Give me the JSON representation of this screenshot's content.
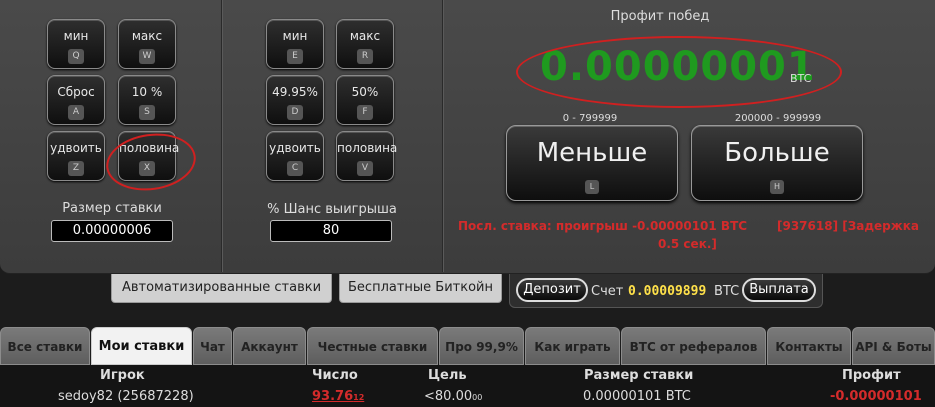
{
  "controls_left": {
    "buttons": [
      {
        "label": "мин",
        "key": "Q"
      },
      {
        "label": "макс",
        "key": "W"
      },
      {
        "label": "Сброс",
        "key": "A"
      },
      {
        "label": "10 %",
        "key": "S"
      },
      {
        "label": "удвоить",
        "key": "Z"
      },
      {
        "label": "половина",
        "key": "X"
      }
    ],
    "field_label": "Размер ставки",
    "field_value": "0.00000006"
  },
  "controls_mid": {
    "buttons": [
      {
        "label": "мин",
        "key": "E"
      },
      {
        "label": "макс",
        "key": "R"
      },
      {
        "label": "49.95%",
        "key": "D"
      },
      {
        "label": "50%",
        "key": "F"
      },
      {
        "label": "удвоить",
        "key": "C"
      },
      {
        "label": "половина",
        "key": "V"
      }
    ],
    "field_label": "% Шанс выигрыша",
    "field_value": "80"
  },
  "profit": {
    "title": "Профит побед",
    "value": "0.00000001",
    "currency": "BTC"
  },
  "bet_buttons": {
    "low_range": "0 - 799999",
    "high_range": "200000 - 999999",
    "low_label": "Меньше",
    "low_key": "L",
    "high_label": "Больше",
    "high_key": "H"
  },
  "last_bet": {
    "line1": "Посл. ставка: проигрыш -0.00000101 BTC",
    "line2": "0.5 сек.]",
    "line3": "[937618] [Задержка"
  },
  "sub_tabs": {
    "auto": "Автоматизированные ставки",
    "free": "Бесплатные Биткойн"
  },
  "account": {
    "deposit": "Депозит",
    "balance_label": "Счет",
    "balance_value": "0.00009899",
    "currency": "BTC",
    "withdraw": "Выплата"
  },
  "tabs": [
    "Все ставки",
    "Мои ставки",
    "Чат",
    "Аккаунт",
    "Честные ставки",
    "Про 99,9%",
    "Как играть",
    "BTC от рефералов",
    "Контакты",
    "API & Боты"
  ],
  "table": {
    "headers": [
      "Игрок",
      "Число",
      "Цель",
      "Размер ставки",
      "Профит"
    ],
    "row": {
      "player": "sedoy82 (25687228)",
      "number_main": "93.76",
      "number_sub": "12",
      "target_main": "<80.00",
      "target_sub": "00",
      "bet": "0.00000101 BTC",
      "profit": "-0.00000101"
    }
  },
  "colors": {
    "profit_green": "#1f9a1f",
    "loss_red": "#d42b2b",
    "balance_yellow": "#ffe14a"
  }
}
